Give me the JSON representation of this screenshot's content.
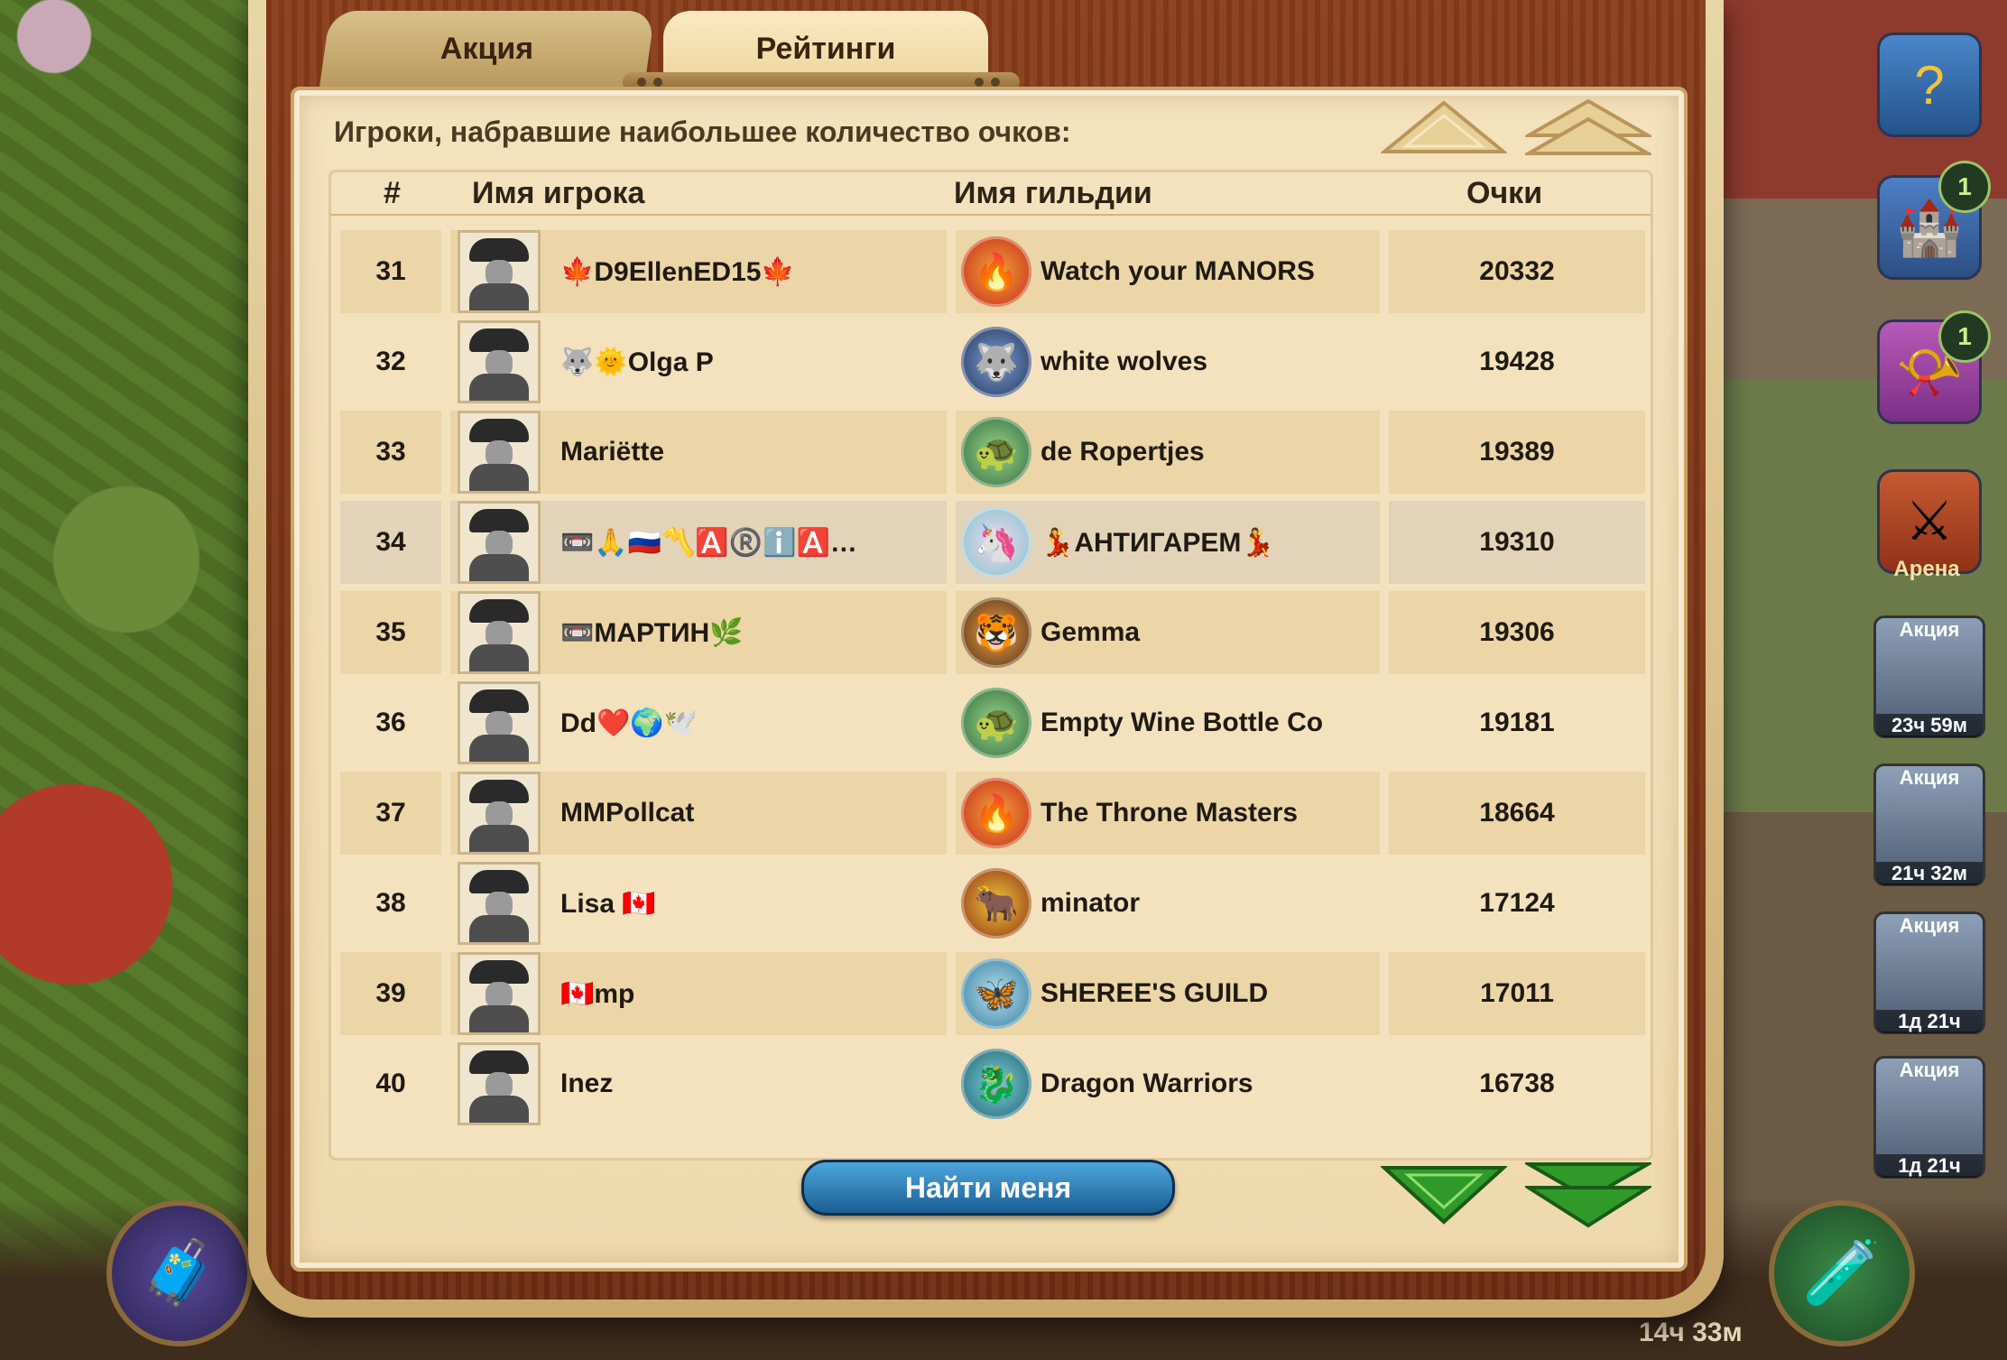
{
  "tabs": [
    {
      "label": "Акция",
      "active": false
    },
    {
      "label": "Рейтинги",
      "active": true
    }
  ],
  "heading": "Игроки, набравшие наибольшее количество очков:",
  "columns": {
    "rank": "#",
    "player": "Имя игрока",
    "guild": "Имя гильдии",
    "points": "Очки"
  },
  "rows": [
    {
      "rank": "31",
      "player": "🍁D9EllenED15🍁",
      "guild": "Watch your MANORS",
      "guild_icon": "phoenix-emblem",
      "points": "20332"
    },
    {
      "rank": "32",
      "player": "🐺🌞Olga P",
      "guild": "white wolves",
      "guild_icon": "wolf-emblem",
      "points": "19428"
    },
    {
      "rank": "33",
      "player": "Mariëtte",
      "guild": "de Ropertjes",
      "guild_icon": "turtle-emblem",
      "points": "19389"
    },
    {
      "rank": "34",
      "player": "📼🙏🇷🇺〽️🅰️®️ℹ️🅰️…",
      "guild": "💃АНТИГАРЕМ💃",
      "guild_icon": "unicorn-emblem",
      "points": "19310",
      "highlighted": true
    },
    {
      "rank": "35",
      "player": "📼МАРТИН🌿",
      "guild": "Gemma",
      "guild_icon": "tiger-emblem",
      "points": "19306"
    },
    {
      "rank": "36",
      "player": "Dd❤️🌍🕊️",
      "guild": "Empty Wine Bottle Co",
      "guild_icon": "turtle-emblem",
      "points": "19181"
    },
    {
      "rank": "37",
      "player": "MMPollcat",
      "guild": "The Throne Masters",
      "guild_icon": "phoenix-emblem",
      "points": "18664"
    },
    {
      "rank": "38",
      "player": "Lisa 🇨🇦",
      "guild": "minator",
      "guild_icon": "bull-emblem",
      "points": "17124"
    },
    {
      "rank": "39",
      "player": "🇨🇦mp",
      "guild": "SHEREE'S GUILD",
      "guild_icon": "butterfly-emblem",
      "points": "17011"
    },
    {
      "rank": "40",
      "player": "Inez",
      "guild": "Dragon Warriors",
      "guild_icon": "dragon-emblem",
      "points": "16738"
    }
  ],
  "find_me_label": "Найти меня",
  "side": {
    "help_badge": "",
    "tower_badge": "1",
    "horn_badge": "1",
    "arena_label": "Арена",
    "promos": [
      {
        "label": "Акция",
        "time": "23ч 59м"
      },
      {
        "label": "Акция",
        "time": "21ч 32м"
      },
      {
        "label": "Акция",
        "time": "1д 21ч"
      },
      {
        "label": "Акция",
        "time": "1д 21ч"
      }
    ]
  },
  "bottom_timer": "14ч 33м",
  "colors": {
    "accent_blue": "#1b5e93",
    "arrow_green": "#2f9a2a",
    "paper": "#f4e2bd",
    "wood": "#7a3314"
  }
}
